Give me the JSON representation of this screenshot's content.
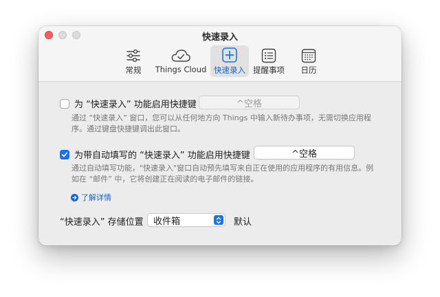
{
  "window": {
    "title": "快速录入"
  },
  "toolbar": {
    "tabs": [
      {
        "id": "general",
        "label": "常规",
        "icon": "sliders-icon"
      },
      {
        "id": "cloud",
        "label": "Things Cloud",
        "icon": "cloud-check-icon"
      },
      {
        "id": "quick_entry",
        "label": "快速录入",
        "icon": "plus-square-icon",
        "selected": true
      },
      {
        "id": "reminders",
        "label": "提醒事项",
        "icon": "list-icon"
      },
      {
        "id": "calendar",
        "label": "日历",
        "icon": "calendar-icon"
      }
    ]
  },
  "quick_entry": {
    "enable_label": "为 “快速录入” 功能启用快捷键",
    "enable_checked": false,
    "enable_shortcut": "^空格",
    "enable_desc_1": "通过 “快速录入” 窗口，您可以从任何地方向 Things 中输入新待办事项，无需切换应用程",
    "enable_desc_2": "序。通过键盘快捷键调出此窗口。",
    "autofill_label": "为带自动填写的 “快速录入” 功能启用快捷键",
    "autofill_checked": true,
    "autofill_shortcut": "^空格",
    "autofill_desc_1": "通过自动填写功能，\"快速录入\"窗口自动预先填写来自正在使用的应用程序的有用信息。例",
    "autofill_desc_2": "如在 “邮件” 中，它将创建正在阅读的电子邮件的链接。",
    "learn_more": "了解详情",
    "save_location_label": "“快速录入” 存储位置",
    "save_location_value": "收件箱",
    "save_location_default": "默认"
  },
  "colors": {
    "accent": "#1a73e8",
    "close": "#ff5f57"
  }
}
